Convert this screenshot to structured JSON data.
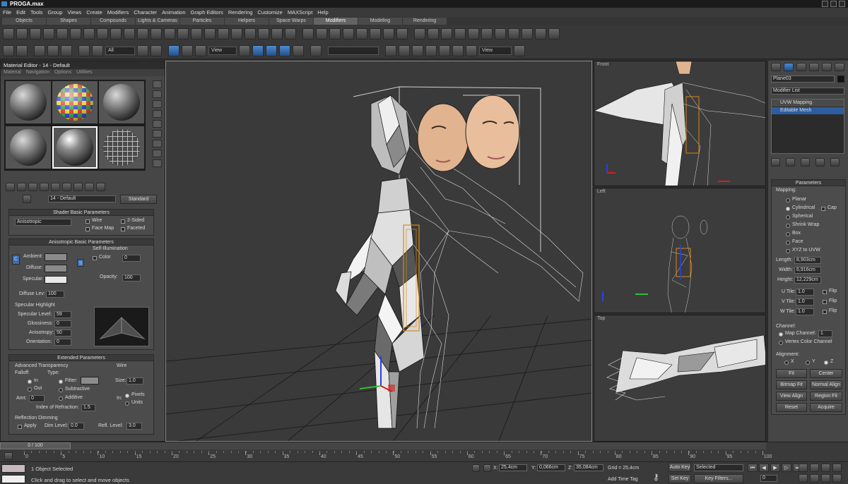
{
  "window": {
    "title": "PROGA.max"
  },
  "menu": [
    "File",
    "Edit",
    "Tools",
    "Group",
    "Views",
    "Create",
    "Modifiers",
    "Character",
    "Animation",
    "Graph Editors",
    "Rendering",
    "Customize",
    "MAXScript",
    "Help"
  ],
  "tabs": [
    {
      "label": "Objects",
      "active": false
    },
    {
      "label": "Shapes",
      "active": false
    },
    {
      "label": "Compounds",
      "active": false
    },
    {
      "label": "Lights & Cameras",
      "active": false
    },
    {
      "label": "Particles",
      "active": false
    },
    {
      "label": "Helpers",
      "active": false
    },
    {
      "label": "Space Warps",
      "active": false
    },
    {
      "label": "Modifiers",
      "active": true
    },
    {
      "label": "Modeling",
      "active": false
    },
    {
      "label": "Rendering",
      "active": false
    }
  ],
  "toolbar2": {
    "filter_value": "All",
    "refcoord_value": "View",
    "named_selection": "",
    "view_value": "View"
  },
  "material_editor": {
    "title": "Material Editor - 14 - Default",
    "menu": [
      "Material",
      "Navigation",
      "Options",
      "Utilities"
    ],
    "material_name": "14 - Default",
    "material_type": "Standard",
    "shader_rollout": "Shader Basic Parameters",
    "shader_value": "Anisotropic",
    "wire_label": "Wire",
    "two_sided_label": "2-Sided",
    "face_map_label": "Face Map",
    "faceted_label": "Faceted",
    "aniso_rollout": "Anisotropic Basic Parameters",
    "self_illum_label": "Self-Illumination",
    "ambient_label": "Ambient:",
    "diffuse_label": "Diffuse:",
    "specular_label": "Specular:",
    "color_label": "Color",
    "color_value": "0",
    "opacity_label": "Opacity:",
    "opacity_value": "100",
    "diffuse_lev_label": "Diffuse Lev:",
    "diffuse_lev_value": "100",
    "specular_highlight_label": "Specular Highlight",
    "specular_level_label": "Specular Level:",
    "specular_level_value": "59",
    "glossiness_label": "Glossiness:",
    "glossiness_value": "0",
    "anisotropy_label": "Anisotropy:",
    "anisotropy_value": "50",
    "orientation_label": "Orientation:",
    "orientation_value": "0",
    "extended_rollout": "Extended Parameters",
    "adv_transparency_label": "Advanced Transparency",
    "wire_group_label": "Wire",
    "falloff_label": "Falloff:",
    "type_label": "Type:",
    "in_label": "In",
    "out_label": "Out",
    "filter_label": "Filter:",
    "subtractive_label": "Subtractive",
    "additive_label": "Additive",
    "size_label": "Size:",
    "size_value": "1.0",
    "amt_label": "Amt:",
    "amt_value": "0",
    "in2_label": "In:",
    "pixels_label": "Pixels",
    "units_label": "Units",
    "ior_label": "Index of Refraction:",
    "ior_value": "1.5",
    "reflection_dimming_label": "Reflection Dimming",
    "apply_label": "Apply",
    "dim_level_label": "Dim Level:",
    "dim_level_value": "0.0",
    "refl_level_label": "Refl. Level:",
    "refl_level_value": "3.0",
    "colors": {
      "ambient": "#8a8a8a",
      "diffuse": "#8a8a8a",
      "specular": "#e8e8e8",
      "filter": "#8c8c8c"
    }
  },
  "viewports": {
    "perspective_label": "",
    "front_label": "Front",
    "left_label": "Left",
    "top_label": "Top"
  },
  "command_panel": {
    "object_name": "Plane03",
    "object_color": "#111111",
    "modifier_list_label": "Modifier List",
    "stack": [
      "UVW Mapping",
      "Editable Mesh"
    ],
    "parameters_rollout": "Parameters",
    "mapping_label": "Mapping:",
    "mapping_options": [
      {
        "label": "Planar",
        "selected": false
      },
      {
        "label": "Cylindrical",
        "selected": true
      },
      {
        "label": "Spherical",
        "selected": false
      },
      {
        "label": "Shrink Wrap",
        "selected": false
      },
      {
        "label": "Box",
        "selected": false
      },
      {
        "label": "Face",
        "selected": false
      },
      {
        "label": "XYZ to UVW",
        "selected": false
      }
    ],
    "cap_label": "Cap",
    "length_label": "Length:",
    "length_value": "8,903cm",
    "width_label": "Width:",
    "width_value": "6,916cm",
    "height_label": "Height:",
    "height_value": "12,229cm",
    "utile_label": "U Tile:",
    "utile_value": "1.0",
    "vtile_label": "V Tile:",
    "vtile_value": "1.0",
    "wtile_label": "W Tile:",
    "wtile_value": "1.0",
    "flip_label": "Flip",
    "channel_label": "Channel:",
    "map_channel_label": "Map Channel:",
    "map_channel_value": "1",
    "vertex_color_channel_label": "Vertex Color Channel",
    "alignment_label": "Alignment:",
    "x_label": "X",
    "y_label": "Y",
    "z_label": "Z",
    "fit_label": "Fit",
    "center_label": "Center",
    "bitmap_fit_label": "Bitmap Fit",
    "normal_align_label": "Normal Align",
    "view_align_label": "View Align",
    "region_fit_label": "Region Fit",
    "reset_label": "Reset",
    "acquire_label": "Acquire"
  },
  "timeline": {
    "frame_display": "0 / 100",
    "ticks": [
      "0",
      "5",
      "10",
      "15",
      "20",
      "25",
      "30",
      "35",
      "40",
      "45",
      "50",
      "55",
      "60",
      "65",
      "70",
      "75",
      "80",
      "85",
      "90",
      "95",
      "100"
    ],
    "current_frame": 0
  },
  "status": {
    "selection_info": "1 Object Selected",
    "prompt": "Click and drag to select and move objects",
    "x_label": "X:",
    "x_value": "25,4cm",
    "y_label": "Y:",
    "y_value": "0,066cm",
    "z_label": "Z:",
    "z_value": "35,084cm",
    "grid_label": "Grid = 25,4cm",
    "add_time_tag": "Add Time Tag",
    "auto_key": "Auto Key",
    "selected_value": "Selected",
    "set_key": "Set Key",
    "key_filters": "Key Filters...",
    "frame_value": "0"
  }
}
